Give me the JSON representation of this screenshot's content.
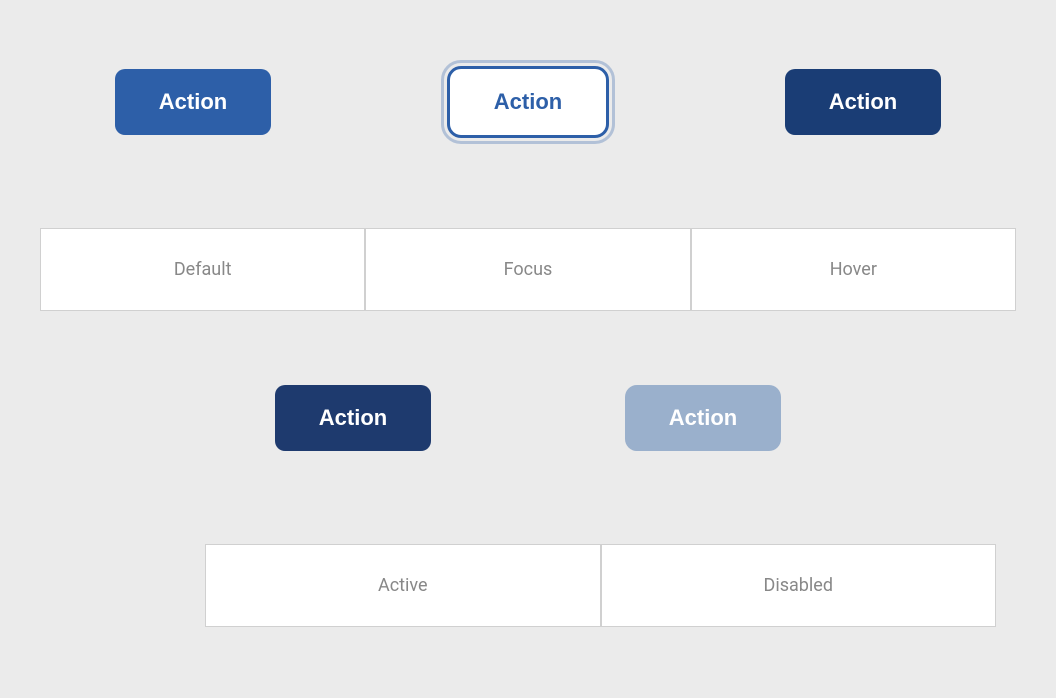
{
  "page": {
    "background": "#ebebeb"
  },
  "row1": {
    "default_btn": {
      "label": "Action",
      "state": "default"
    },
    "focus_btn": {
      "label": "Action",
      "state": "focus"
    },
    "hover_btn": {
      "label": "Action",
      "state": "hover"
    }
  },
  "row2": {
    "labels": [
      {
        "text": "Default"
      },
      {
        "text": "Focus"
      },
      {
        "text": "Hover"
      }
    ]
  },
  "row3": {
    "active_btn": {
      "label": "Action",
      "state": "active"
    },
    "disabled_btn": {
      "label": "Action",
      "state": "disabled"
    }
  },
  "row4": {
    "labels": [
      {
        "text": "Active"
      },
      {
        "text": "Disabled"
      }
    ]
  }
}
